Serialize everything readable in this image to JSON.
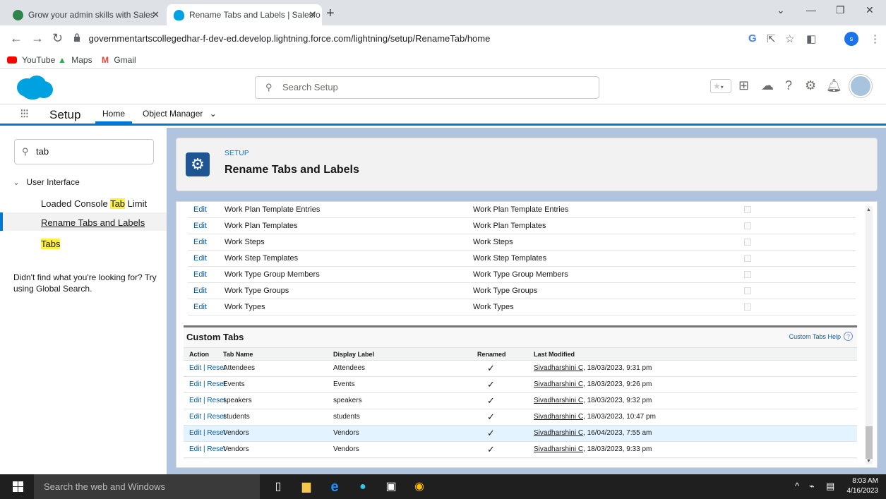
{
  "browser": {
    "tabs": [
      {
        "title": "Grow your admin skills with Sales"
      },
      {
        "title": "Rename Tabs and Labels | Salesfo"
      }
    ],
    "url": "governmentartscollegedhar-f-dev-ed.develop.lightning.force.com/lightning/setup/RenameTab/home",
    "profile_initial": "s",
    "bookmarks": [
      "YouTube",
      "Maps",
      "Gmail"
    ]
  },
  "header": {
    "search_placeholder": "Search Setup"
  },
  "nav": {
    "app_name": "Setup",
    "home_tab": "Home",
    "object_manager_tab": "Object Manager"
  },
  "sidebar": {
    "quick_find_value": "tab",
    "group_label": "User Interface",
    "items": [
      {
        "pre": "Loaded Console ",
        "hl": "Tab",
        "post": " Limit"
      },
      {
        "label": "Rename Tabs and Labels"
      },
      {
        "hl": "Tabs"
      }
    ],
    "help_text": "Didn't find what you're looking for? Try using Global Search."
  },
  "page": {
    "eyebrow": "SETUP",
    "title": "Rename Tabs and Labels"
  },
  "standard_rows": [
    {
      "action": "Edit",
      "tab_name": "Work Plan Template Entries",
      "display_label": "Work Plan Template Entries"
    },
    {
      "action": "Edit",
      "tab_name": "Work Plan Templates",
      "display_label": "Work Plan Templates"
    },
    {
      "action": "Edit",
      "tab_name": "Work Steps",
      "display_label": "Work Steps"
    },
    {
      "action": "Edit",
      "tab_name": "Work Step Templates",
      "display_label": "Work Step Templates"
    },
    {
      "action": "Edit",
      "tab_name": "Work Type Group Members",
      "display_label": "Work Type Group Members"
    },
    {
      "action": "Edit",
      "tab_name": "Work Type Groups",
      "display_label": "Work Type Groups"
    },
    {
      "action": "Edit",
      "tab_name": "Work Types",
      "display_label": "Work Types"
    }
  ],
  "custom_tabs": {
    "title": "Custom Tabs",
    "help_link": "Custom Tabs Help",
    "columns": [
      "Action",
      "Tab Name",
      "Display Label",
      "Renamed",
      "Last Modified"
    ],
    "rows": [
      {
        "action": "Edit | Reset",
        "tab_name": "Attendees",
        "display_label": "Attendees",
        "renamed": "✓",
        "modified_by": "Sivadharshini C",
        "modified_at": ", 18/03/2023, 9:31 pm"
      },
      {
        "action": "Edit | Reset",
        "tab_name": "Events",
        "display_label": "Events",
        "renamed": "✓",
        "modified_by": "Sivadharshini C",
        "modified_at": ", 18/03/2023, 9:26 pm"
      },
      {
        "action": "Edit | Reset",
        "tab_name": "speakers",
        "display_label": "speakers",
        "renamed": "✓",
        "modified_by": "Sivadharshini C",
        "modified_at": ", 18/03/2023, 9:32 pm"
      },
      {
        "action": "Edit | Reset",
        "tab_name": "students",
        "display_label": "students",
        "renamed": "✓",
        "modified_by": "Sivadharshini C",
        "modified_at": ", 18/03/2023, 10:47 pm"
      },
      {
        "action": "Edit | Reset",
        "tab_name": "Vendors",
        "display_label": "Vendors",
        "renamed": "✓",
        "modified_by": "Sivadharshini C",
        "modified_at": ", 16/04/2023, 7:55 am"
      },
      {
        "action": "Edit | Reset",
        "tab_name": "Vendors",
        "display_label": "Vendors",
        "renamed": "✓",
        "modified_by": "Sivadharshini C",
        "modified_at": ", 18/03/2023, 9:33 pm"
      }
    ]
  },
  "taskbar": {
    "search_placeholder": "Search the web and Windows",
    "time": "8:03 AM",
    "date": "4/16/2023"
  },
  "colors": {
    "brand": "#0176d3",
    "link": "#015ba7",
    "highlight": "#fff03f"
  }
}
